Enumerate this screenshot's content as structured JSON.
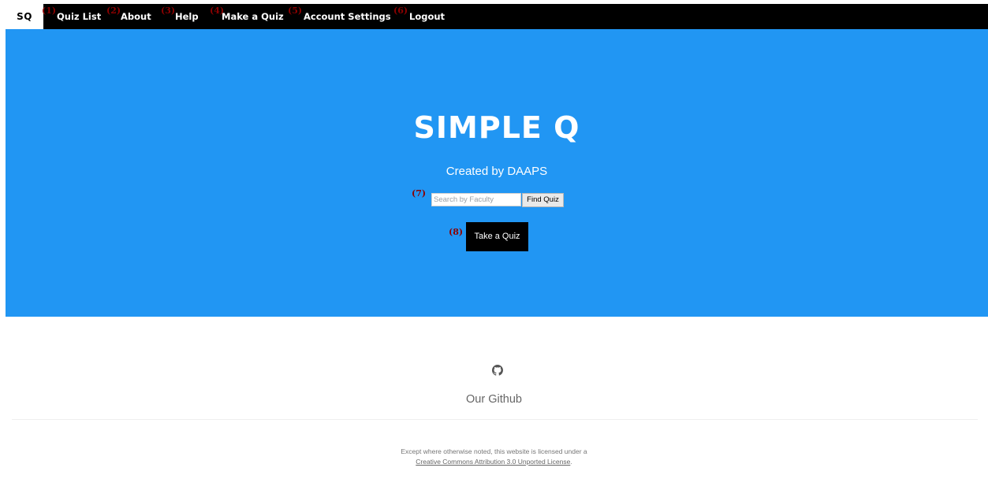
{
  "nav": {
    "brand": "SQ",
    "items": [
      {
        "marker": "(1)",
        "label": "Quiz List"
      },
      {
        "marker": "(2)",
        "label": "About"
      },
      {
        "marker": "(3)",
        "label": "Help"
      },
      {
        "marker": "(4)",
        "label": "Make a Quiz"
      },
      {
        "marker": "(5)",
        "label": "Account Settings"
      },
      {
        "marker": "(6)",
        "label": "Logout"
      }
    ]
  },
  "hero": {
    "title": "SIMPLE Q",
    "subtitle": "Created by DAAPS",
    "search": {
      "marker": "(7)",
      "placeholder": "Search by Faculty",
      "value": "",
      "button_label": "Find Quiz"
    },
    "take_quiz": {
      "marker": "(8)",
      "label": "Take a Quiz"
    }
  },
  "footer": {
    "github_icon": "github-icon",
    "github_label": "Our Github",
    "license_text": "Except where otherwise noted, this website is licensed under a",
    "license_link": "Creative Commons Attribution 3.0 Unported License",
    "license_end": "."
  },
  "colors": {
    "nav_bg": "#000000",
    "hero_bg": "#2196f3",
    "marker": "#8b0000",
    "take_quiz_bg": "#000000"
  }
}
